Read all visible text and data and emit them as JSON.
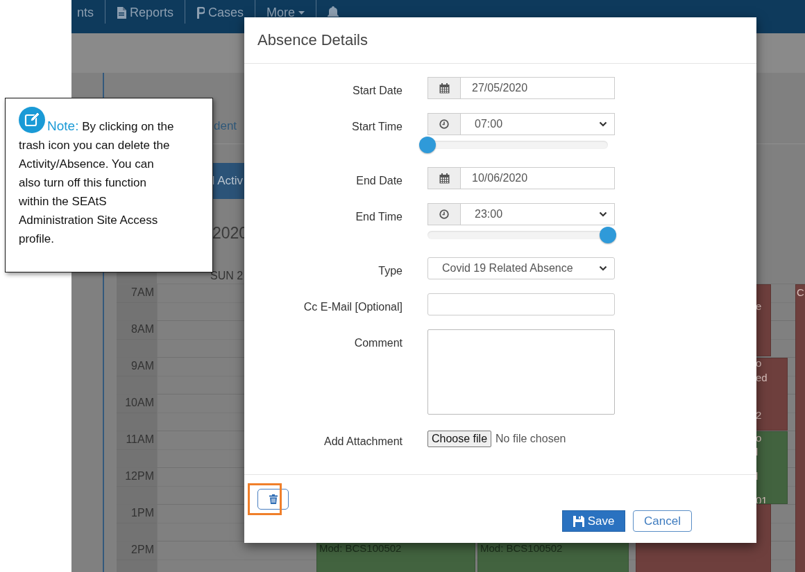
{
  "nav": {
    "items": [
      {
        "kind": "text",
        "label": "nts"
      },
      {
        "kind": "document",
        "label": "Reports"
      },
      {
        "kind": "cases",
        "label": "Cases"
      },
      {
        "kind": "dropdown",
        "label": "More"
      },
      {
        "kind": "bell"
      }
    ]
  },
  "tab_link": "dent",
  "activity_bar": "l Activ",
  "calendar": {
    "heading": "2020",
    "day_header": "SUN 2",
    "times": [
      "7AM",
      "8AM",
      "9AM",
      "10AM",
      "11AM",
      "12PM",
      "1PM",
      "2PM"
    ],
    "events": [
      {
        "color": "#6e3f3d",
        "lines": [
          "e"
        ]
      },
      {
        "color": "#6e3f3d",
        "lines": [
          "o",
          "ed",
          "2"
        ]
      },
      {
        "color": "#42633f",
        "lines": [
          "o",
          "l",
          "l",
          "01"
        ]
      },
      {
        "color": "#6e3f3d"
      },
      {
        "color": "#6e3f3d",
        "lines": [
          "C"
        ]
      },
      {
        "color": "#42633f",
        "lines": [
          "Mod: BCS100502"
        ]
      },
      {
        "color": "#42633f",
        "lines": [
          "Mod: BCS100502"
        ]
      }
    ]
  },
  "note": {
    "title": "Note:",
    "body": "By clicking on the trash icon you can delete the Activity/Absence. You can also turn off this function within the SEAtS Administration Site Access profile."
  },
  "modal": {
    "title": "Absence Details",
    "rows": [
      {
        "kind": "date",
        "label": "Start Date",
        "value": "27/05/2020"
      },
      {
        "kind": "time",
        "label": "Start Time",
        "value": "07:00",
        "level": 0
      },
      {
        "kind": "date",
        "label": "End Date",
        "value": "10/06/2020"
      },
      {
        "kind": "time",
        "label": "End Time",
        "value": "23:00",
        "level": 1
      },
      {
        "kind": "select",
        "label": "Type",
        "value": "Covid 19 Related Absence"
      },
      {
        "kind": "text",
        "label": "Cc E-Mail [Optional]"
      },
      {
        "kind": "textarea",
        "label": "Comment"
      },
      {
        "kind": "file",
        "label": "Add Attachment",
        "button": "Choose file",
        "status": "No file chosen"
      }
    ],
    "save": "Save",
    "cancel": "Cancel"
  }
}
